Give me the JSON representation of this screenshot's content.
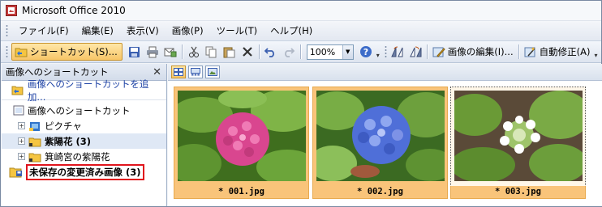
{
  "window": {
    "title": "Microsoft Office 2010"
  },
  "menu": {
    "items": [
      "ファイル(F)",
      "編集(E)",
      "表示(V)",
      "画像(P)",
      "ツール(T)",
      "ヘルプ(H)"
    ]
  },
  "toolbar": {
    "shortcut_label": "ショートカット(S)...",
    "zoom_value": "100%",
    "edit_picture_label": "画像の編集(I)...",
    "auto_correct_label": "自動修正(A)"
  },
  "left_pane": {
    "title": "画像へのショートカット",
    "add_shortcut_link": "画像へのショートカットを追加...",
    "tree": {
      "root": "画像へのショートカット",
      "items": [
        "ピクチャ",
        "紫陽花 (3)",
        "箕崎宮の紫陽花"
      ],
      "unsaved": "未保存の変更済み画像 (3)"
    }
  },
  "thumbnails": [
    {
      "caption": "* 001.jpg",
      "flower_color": "#d9468f"
    },
    {
      "caption": "* 002.jpg",
      "flower_color": "#4f6fd8"
    },
    {
      "caption": "* 003.jpg",
      "flower_color": "#ffffff"
    }
  ],
  "colors": {
    "selection": "#f9c47a",
    "highlight_border": "#e0141c",
    "link": "#1a3fa3"
  }
}
